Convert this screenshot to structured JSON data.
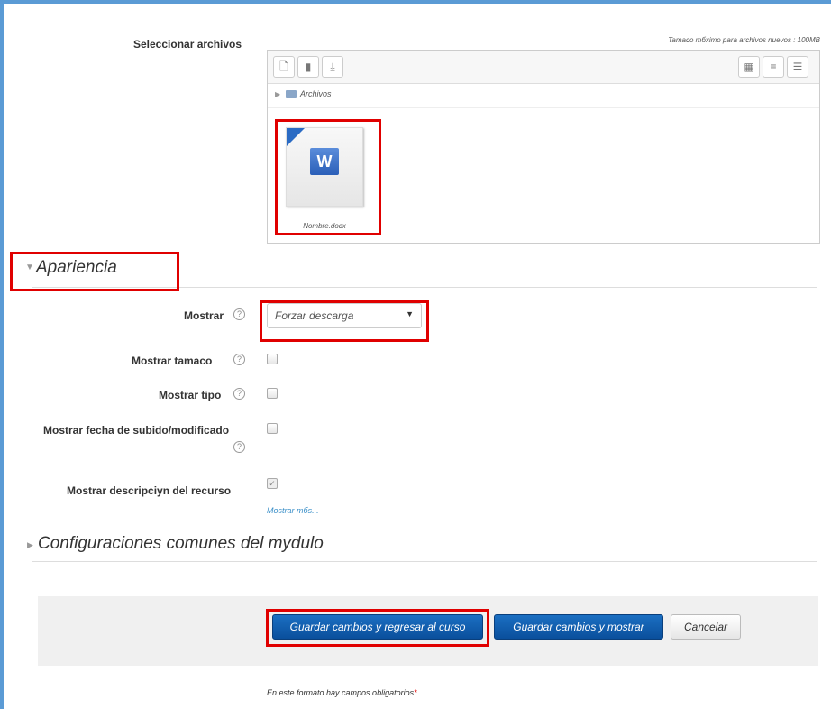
{
  "file_section": {
    "label": "Seleccionar archivos",
    "max_size": "Tamaco mбximo para archivos nuevos : 100MB",
    "breadcrumb": "Archivos",
    "file_name": "Nombre.docx",
    "file_icon_letter": "W"
  },
  "appearance": {
    "header": "Apariencia",
    "mostrar_label": "Mostrar",
    "mostrar_value": "Forzar descarga",
    "options": [
      {
        "label": "Mostrar tamaco",
        "checked": false
      },
      {
        "label": "Mostrar tipo",
        "checked": false
      },
      {
        "label": "Mostrar fecha de subido/modificado",
        "checked": false
      },
      {
        "label": "Mostrar descripciyn del recurso",
        "checked": true
      }
    ],
    "show_more": "Mostrar mбs..."
  },
  "common_settings": {
    "header": "Configuraciones comunes del mуdulo"
  },
  "actions": {
    "save_return": "Guardar cambios y regresar al curso",
    "save_show": "Guardar cambios y mostrar",
    "cancel": "Cancelar"
  },
  "footer": {
    "required_note": "En este formato hay campos obligatorios",
    "required_mark": "*"
  },
  "colors": {
    "frame": "#5b9bd5",
    "highlight": "#e00000",
    "primary_button": "#0a4f9c"
  }
}
